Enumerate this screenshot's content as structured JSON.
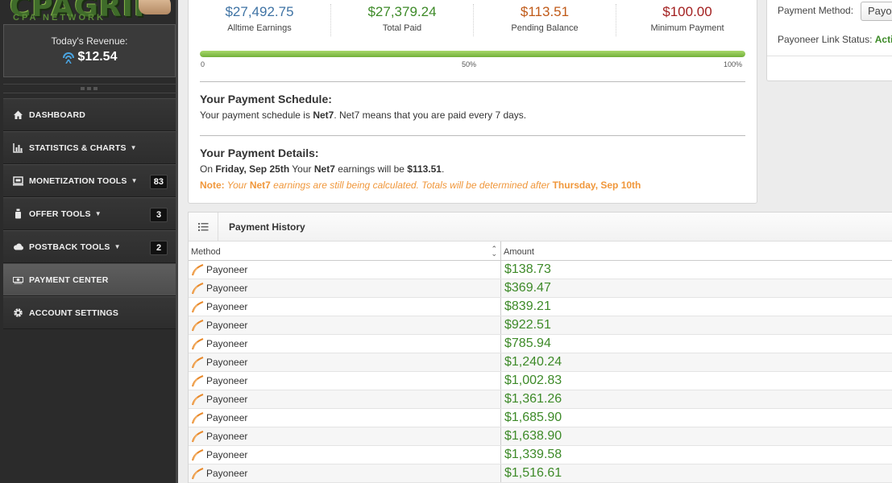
{
  "sidebar": {
    "logo_text": "CPAGRIP",
    "logo_sub": "CPA NETWORK",
    "revenue_label": "Today's Revenue:",
    "revenue_value": "$12.54",
    "nav": [
      {
        "label": "DASHBOARD",
        "icon": "home-icon",
        "caret": "",
        "badge": ""
      },
      {
        "label": "STATISTICS & CHARTS",
        "icon": "bar-chart-icon",
        "caret": "▼",
        "badge": ""
      },
      {
        "label": "MONETIZATION TOOLS",
        "icon": "screen-icon",
        "caret": "▼",
        "badge": "83"
      },
      {
        "label": "OFFER TOOLS",
        "icon": "bottle-icon",
        "caret": "▼",
        "badge": "3"
      },
      {
        "label": "POSTBACK TOOLS",
        "icon": "cloud-icon",
        "caret": "▼",
        "badge": "2"
      },
      {
        "label": "PAYMENT CENTER",
        "icon": "money-icon",
        "caret": "",
        "badge": ""
      },
      {
        "label": "ACCOUNT SETTINGS",
        "icon": "gear-icon",
        "caret": "",
        "badge": ""
      }
    ]
  },
  "stats": [
    {
      "value": "$27,492.75",
      "label": "Alltime Earnings",
      "color": "#3f73a4"
    },
    {
      "value": "$27,379.24",
      "label": "Total Paid",
      "color": "#3d8a28"
    },
    {
      "value": "$113.51",
      "label": "Pending Balance",
      "color": "#c05a18"
    },
    {
      "value": "$100.00",
      "label": "Minimum Payment",
      "color": "#a32020"
    }
  ],
  "progress": {
    "fraction": 1.0,
    "label_start": "0",
    "label_mid": "50%",
    "label_end": "100%"
  },
  "schedule": {
    "title": "Your Payment Schedule:",
    "text_prefix": "Your payment schedule is ",
    "net": "Net7",
    "text_suffix": ". Net7 means that you are paid every 7 days."
  },
  "details": {
    "title": "Your Payment Details:",
    "on": "On ",
    "date": "Friday, Sep 25th",
    "your": " Your ",
    "net": "Net7",
    "mid": " earnings will be ",
    "amount": "$113.51",
    "end": ".",
    "note_label": "Note:",
    "note_a": " Your ",
    "note_net": "Net7",
    "note_b": " earnings are still being calculated. Totals will be determined after ",
    "note_date": "Thursday, Sep 10th"
  },
  "right_panel": {
    "method_label": "Payment Method:",
    "method_value": "Payoneer",
    "link_status_label": "Payoneer Link Status:",
    "link_status_value": "Active"
  },
  "history": {
    "title": "Payment History",
    "col_method": "Method",
    "col_amount": "Amount",
    "rows": [
      {
        "method": "Payoneer",
        "amount": "$138.73"
      },
      {
        "method": "Payoneer",
        "amount": "$369.47"
      },
      {
        "method": "Payoneer",
        "amount": "$839.21"
      },
      {
        "method": "Payoneer",
        "amount": "$922.51"
      },
      {
        "method": "Payoneer",
        "amount": "$785.94"
      },
      {
        "method": "Payoneer",
        "amount": "$1,240.24"
      },
      {
        "method": "Payoneer",
        "amount": "$1,002.83"
      },
      {
        "method": "Payoneer",
        "amount": "$1,361.26"
      },
      {
        "method": "Payoneer",
        "amount": "$1,685.90"
      },
      {
        "method": "Payoneer",
        "amount": "$1,638.90"
      },
      {
        "method": "Payoneer",
        "amount": "$1,339.58"
      },
      {
        "method": "Payoneer",
        "amount": "$1,516.61"
      }
    ]
  }
}
